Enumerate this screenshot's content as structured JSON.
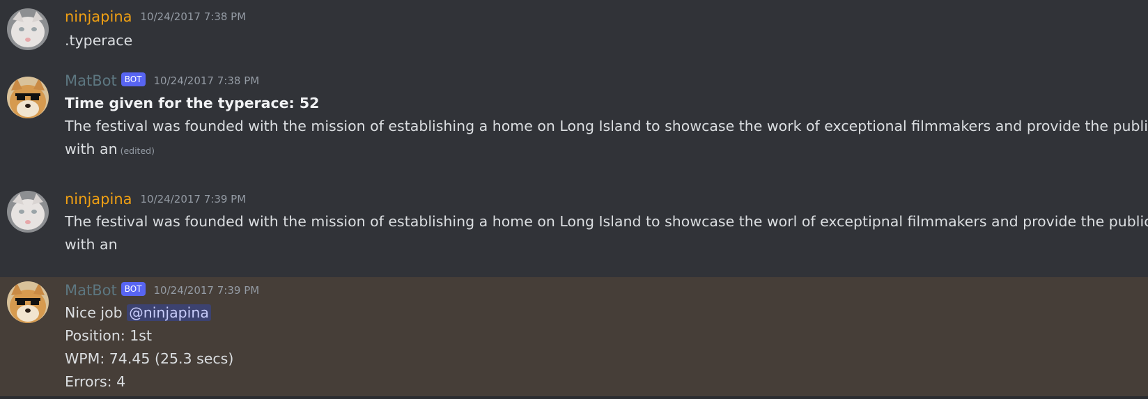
{
  "messages": [
    {
      "author": "ninjapina",
      "timestamp": "10/24/2017 7:38 PM",
      "lines": [
        ".typerace"
      ]
    },
    {
      "author": "MatBot",
      "bot_tag": "BOT",
      "timestamp": "10/24/2017 7:38 PM",
      "bold_line": "Time given for the typerace: 52",
      "line1": "The festival was founded with the mission of establishing a home on Long Island to showcase the work of exceptional filmmakers and provide the public",
      "line2": "with an",
      "edited": "(edited)"
    },
    {
      "author": "ninjapina",
      "timestamp": "10/24/2017 7:39 PM",
      "line1": "The festival was founded with the mission of establishing a home on Long Island to showcase the worl of exceptipnal filmmakers and provide the public",
      "line2": "with an"
    },
    {
      "author": "MatBot",
      "bot_tag": "BOT",
      "timestamp": "10/24/2017 7:39 PM",
      "nice_job": "Nice job",
      "mention": "@ninjapina",
      "position": "Position: 1st",
      "wpm": "WPM: 74.45 (25.3 secs)",
      "errors": "Errors: 4"
    }
  ],
  "colors": {
    "background": "#313338",
    "highlight": "#463e38",
    "ninjapina_name": "#f0a013",
    "matbot_name": "#5d7781",
    "bot_tag": "#5865f2",
    "timestamp": "#949ba4",
    "mention_bg": "#3c4270"
  },
  "icons": [
    "cat-avatar-icon",
    "doge-sunglasses-avatar-icon"
  ]
}
